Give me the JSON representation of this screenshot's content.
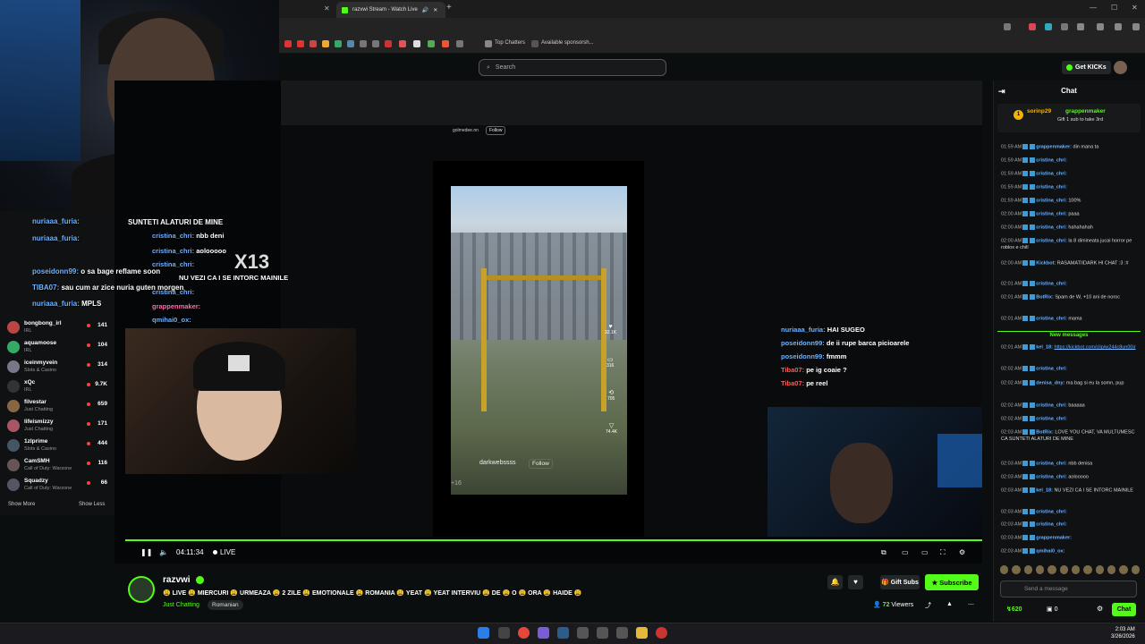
{
  "browser": {
    "tab_title": "razvwi Stream - Watch Live",
    "bookmarks": [
      "Top Chatters",
      "Available sponsorsh..."
    ]
  },
  "kick": {
    "search_placeholder": "Search",
    "get_kicks": "Get KICKs"
  },
  "sidebar": {
    "items": [
      {
        "name": "bongbong_irl",
        "category": "IRL",
        "viewers": "141",
        "color": "#b44"
      },
      {
        "name": "aquamoose",
        "category": "IRL",
        "viewers": "104",
        "color": "#3a6"
      },
      {
        "name": "iceinmyvein",
        "category": "Slots & Casino",
        "viewers": "314",
        "color": "#778"
      },
      {
        "name": "xQc",
        "category": "IRL",
        "viewers": "9.7K",
        "color": "#333"
      },
      {
        "name": "filvestar",
        "category": "Just Chatting",
        "viewers": "659",
        "color": "#864"
      },
      {
        "name": "lifeismizzy",
        "category": "Just Chatting",
        "viewers": "171",
        "color": "#a56"
      },
      {
        "name": "1zlprime",
        "category": "Slots & Casino",
        "viewers": "444",
        "color": "#456"
      },
      {
        "name": "CamSMH",
        "category": "Call of Duty: Warzone",
        "viewers": "116",
        "color": "#655"
      },
      {
        "name": "Squadzy",
        "category": "Call of Duty: Warzone",
        "viewers": "66",
        "color": "#556"
      }
    ],
    "show_more": "Show More",
    "show_less": "Show Less"
  },
  "overlay_chat": [
    {
      "user": "nuriaaa_furia:",
      "text": ""
    },
    {
      "user": "nuriaaa_furia:",
      "text": ""
    },
    {
      "user": "poseidonn99:",
      "text": "o sa bage reflame soon"
    },
    {
      "user": "TIBA07:",
      "text": "sau cum ar zice nuria guten morgen"
    },
    {
      "user": "nuriaaa_furia:",
      "text": "MPLS"
    }
  ],
  "overlay_chat_right": [
    {
      "user": "cristina_chri:",
      "text": "nbb deni"
    },
    {
      "user": "cristina_chri:",
      "text": "aolooooo"
    },
    {
      "user": "cristina_chri:",
      "text": ""
    },
    {
      "user": "",
      "text": "NU VEZI CA I SE INTORC MAINILE"
    },
    {
      "user": "cristina_chri:",
      "text": ""
    },
    {
      "user": "grappenmaker:",
      "text": ""
    },
    {
      "user": "qmihai0_ox:",
      "text": ""
    }
  ],
  "overlay_banner": "SUNTETI ALATURI DE MINE",
  "overlay_x13": "X13",
  "inner_chat": [
    {
      "user": "nuriaaa_furia:",
      "text": "HAI SUGEO"
    },
    {
      "user": "poseidonn99:",
      "text": "de ii rupe barca picioarele"
    },
    {
      "user": "poseidonn99:",
      "text": "fmmm"
    },
    {
      "user": "Tiba07:",
      "text": "pe ig coaie ?"
    },
    {
      "user": "Tiba07:",
      "text": "pe reel"
    }
  ],
  "tiktok": {
    "top_user": "golmedee.nn",
    "top_follow": "Follow",
    "user": "darkwebssss",
    "follow": "Follow",
    "likes": "32.1K",
    "comments": "316",
    "shares": "705",
    "saves": "74.4K",
    "count": "+16"
  },
  "player": {
    "time": "04:11:34",
    "live": "LIVE"
  },
  "stream": {
    "channel": "razvwi",
    "title": "😩 LIVE 😩 MIERCURI 😩 URMEAZA 😩 2 ZILE 😩 EMOTIONALE 😩 ROMANIA 😩 YEAT 😩 YEAT INTERVIU 😩 DE 😩 O 😩 ORA 😩 HAIDE 😩",
    "category": "Just Chatting",
    "tag": "Romanian",
    "gift_subs": "Gift Subs",
    "subscribe": "Subscribe",
    "viewers": "72",
    "viewers_label": "Viewers"
  },
  "chat": {
    "header": "Chat",
    "pinned_user": "sorinp29",
    "pinned_user2": "grappenmaker",
    "pinned_text": "Gift 1 sub to take 3rd",
    "messages": [
      {
        "time": "01:59 AM",
        "user": "grappenmaker:",
        "text": "din mana ta"
      },
      {
        "time": "01:59 AM",
        "user": "cristina_chri:",
        "text": ""
      },
      {
        "time": "01:59 AM",
        "user": "cristina_chri:",
        "text": ""
      },
      {
        "time": "01:59 AM",
        "user": "cristina_chri:",
        "text": ""
      },
      {
        "time": "01:59 AM",
        "user": "cristina_chri:",
        "text": "100%"
      },
      {
        "time": "02:00 AM",
        "user": "cristina_chri:",
        "text": "paaa"
      },
      {
        "time": "02:00 AM",
        "user": "cristina_chri:",
        "text": "hahahahah"
      },
      {
        "time": "02:00 AM",
        "user": "cristina_chri:",
        "text": "la 8 dimineata jucai horror pe roblox e chill"
      },
      {
        "time": "02:00 AM",
        "user": "Kickbot:",
        "text": "RASAMATIIDARK HI CHAT :3 :#"
      },
      {
        "time": "02:01 AM",
        "user": "cristina_chri:",
        "text": ""
      },
      {
        "time": "02:01 AM",
        "user": "BotRix:",
        "text": "Spam de W, +10 ani de noroc"
      },
      {
        "time": "02:01 AM",
        "user": "cristina_chri:",
        "text": "mama"
      }
    ],
    "new_messages": "New messages",
    "messages2": [
      {
        "time": "02:01 AM",
        "user": "kel_18:",
        "text": "https://kickbot.com/clip/w244c8un00ir"
      },
      {
        "time": "02:02 AM",
        "user": "cristina_chri:",
        "text": ""
      },
      {
        "time": "02:02 AM",
        "user": "denisa_dny:",
        "text": "ma bag si eu la somn, pup"
      },
      {
        "time": "02:02 AM",
        "user": "cristina_chri:",
        "text": "baaaaa"
      },
      {
        "time": "02:02 AM",
        "user": "cristina_chri:",
        "text": ""
      },
      {
        "time": "02:03 AM",
        "user": "BotRix:",
        "text": "LOVE YOU CHAT, VA MULTUMESC CA SUNTETI ALATURI DE MINE"
      },
      {
        "time": "02:03 AM",
        "user": "cristina_chri:",
        "text": "nbb denisa"
      },
      {
        "time": "02:03 AM",
        "user": "cristina_chri:",
        "text": "aolooooo"
      },
      {
        "time": "02:03 AM",
        "user": "kel_18:",
        "text": "NU VEZI CA I SE INTORC MAINILE"
      },
      {
        "time": "02:03 AM",
        "user": "cristina_chri:",
        "text": ""
      },
      {
        "time": "02:03 AM",
        "user": "cristina_chri:",
        "text": ""
      },
      {
        "time": "02:03 AM",
        "user": "grappenmaker:",
        "text": ""
      },
      {
        "time": "02:03 AM",
        "user": "qmihai0_ox:",
        "text": ""
      }
    ],
    "send_placeholder": "Send a message",
    "kicks": "620",
    "zero": "0",
    "chat_button": "Chat"
  },
  "taskbar": {
    "time": "2:03 AM",
    "date": "3/26/2026"
  },
  "colors": {
    "accent": "#53fc18",
    "background": "#0b0e0f",
    "panel": "#0f1112"
  }
}
